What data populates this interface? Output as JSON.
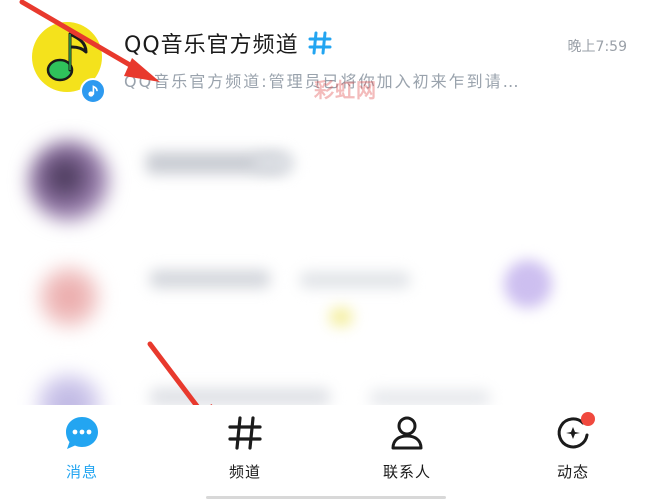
{
  "chat_list": {
    "items": [
      {
        "title": "QQ音乐官方频道",
        "time": "晚上7:59",
        "preview": "QQ音乐官方频道:管理员已将你加入初来乍到请…",
        "avatar_icon": "music-note-icon",
        "badge_icon": "music-note-icon",
        "title_icon": "hash-icon"
      }
    ]
  },
  "watermark": "彩虹网",
  "tab_bar": {
    "tabs": [
      {
        "label": "消息",
        "icon": "message-bubble-icon",
        "active": true
      },
      {
        "label": "频道",
        "icon": "hash-icon",
        "active": false
      },
      {
        "label": "联系人",
        "icon": "person-icon",
        "active": false
      },
      {
        "label": "动态",
        "icon": "star-orbit-icon",
        "active": false,
        "has_dot": true
      }
    ]
  },
  "colors": {
    "accent_blue": "#23a5f1",
    "qq_music_yellow": "#f4e21c",
    "qq_music_green": "#2fc25b",
    "badge_red": "#f0493e",
    "arrow_red": "#e8392d"
  }
}
